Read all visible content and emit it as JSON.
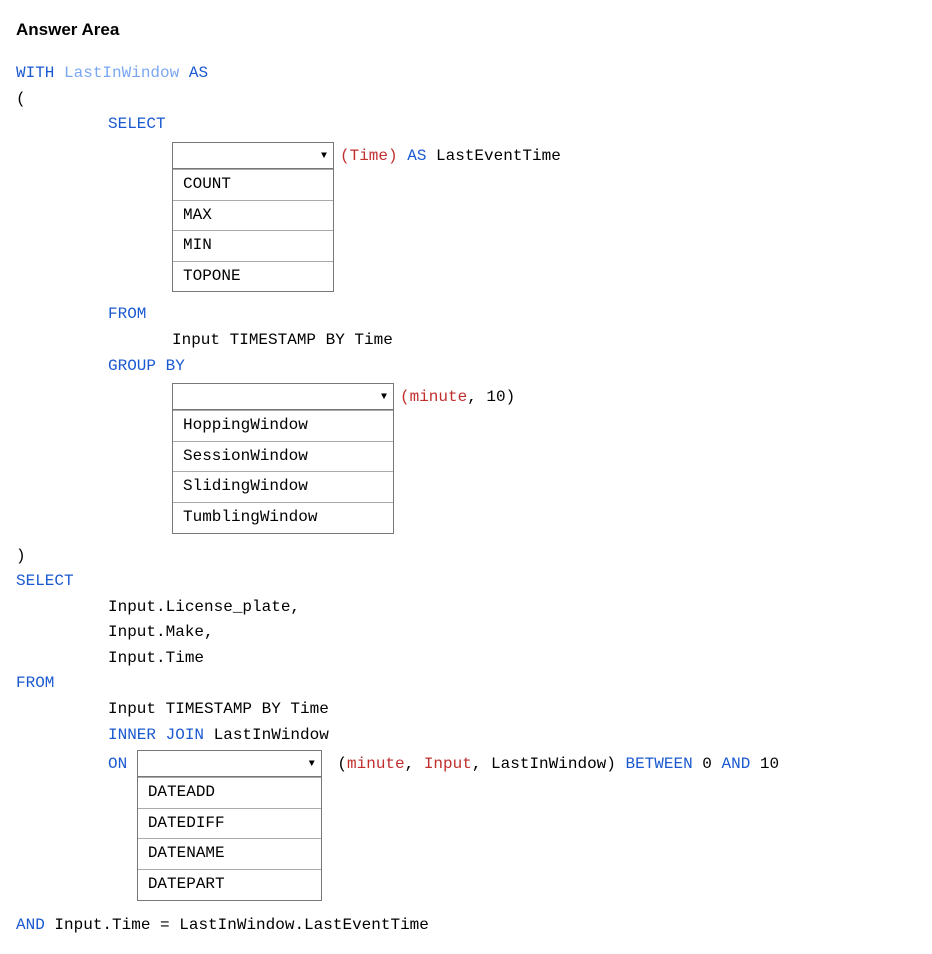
{
  "title": "Answer Area",
  "q": {
    "with_kw": "WITH",
    "cte": "LastInWindow",
    "as_kw": "AS",
    "paren_open": "(",
    "paren_close": ")",
    "select_kw": "SELECT",
    "dd1_trail_time": "(Time)",
    "dd1_trail_as": " AS ",
    "dd1_trail_name": "LastEventTime",
    "from_kw": "FROM",
    "from_line": "Input TIMESTAMP BY Time",
    "group_by_kw": "GROUP BY",
    "dd2_trail_arg": "(minute",
    "dd2_trail_num": ", 10)",
    "outer_select_kw": "SELECT",
    "sel1": "Input.License_plate,",
    "sel2": "Input.Make,",
    "sel3": "Input.Time",
    "outer_from_kw": "FROM",
    "from2_line": "Input TIMESTAMP BY Time",
    "inner_join_kw": "INNER JOIN",
    "join_target": " LastInWindow",
    "on_kw": "ON",
    "dd3_trail_open": " (",
    "dd3_trail_minute": "minute",
    "dd3_trail_comma1": ", ",
    "dd3_trail_input": "Input",
    "dd3_trail_comma2": ", ",
    "dd3_trail_target": "LastInWindow) ",
    "between_kw": "BETWEEN",
    "num0": " 0 ",
    "and_kw": "AND",
    "num10": " 10",
    "final_and": "AND",
    "final_line": " Input.Time = LastInWindow.LastEventTime"
  },
  "dropdown1": {
    "options": [
      "COUNT",
      "MAX",
      "MIN",
      "TOPONE"
    ]
  },
  "dropdown2": {
    "options": [
      "HoppingWindow",
      "SessionWindow",
      "SlidingWindow",
      "TumblingWindow"
    ]
  },
  "dropdown3": {
    "options": [
      "DATEADD",
      "DATEDIFF",
      "DATENAME",
      "DATEPART"
    ]
  }
}
